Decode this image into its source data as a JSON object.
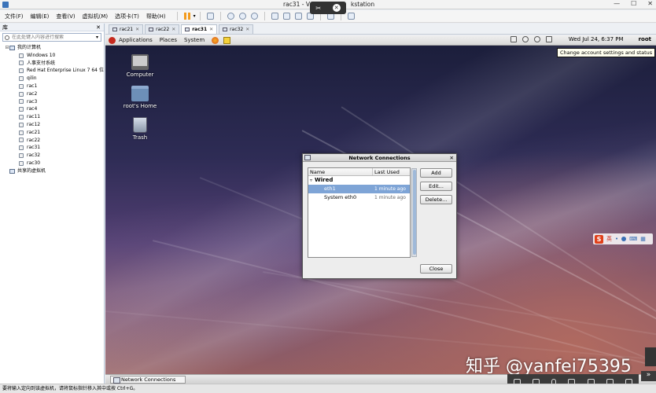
{
  "window": {
    "title": "rac31 - VMware Workstation",
    "title_visible": "rac31 - V",
    "title_tail": "kstation",
    "controls": [
      "minimize-icon",
      "maximize-icon",
      "close-icon"
    ]
  },
  "remote_pill": {
    "icons": [
      "pin-icon",
      "close-icon"
    ]
  },
  "menu": {
    "items": [
      "文件(F)",
      "编辑(E)",
      "查看(V)",
      "虚拟机(M)",
      "选项卡(T)",
      "帮助(H)"
    ]
  },
  "library": {
    "title": "库",
    "search_placeholder": "在此处键入内容进行搜索",
    "root": "我的计算机",
    "vms": [
      "Windows 10",
      "人事支付系统",
      "Red Hat Enterprise Linux 7 64 位",
      "qilin",
      "rac1",
      "rac2",
      "rac3",
      "rac4",
      "rac11",
      "rac12",
      "rac21",
      "rac22",
      "rac31",
      "rac32",
      "rac30"
    ],
    "shared": "共享的虚拟机"
  },
  "tabs": [
    {
      "label": "rac21",
      "active": false
    },
    {
      "label": "rac22",
      "active": false
    },
    {
      "label": "rac31",
      "active": true
    },
    {
      "label": "rac32",
      "active": false
    }
  ],
  "guest_panel": {
    "applications": "Applications",
    "places": "Places",
    "system": "System",
    "clock": "Wed Jul 24,  6:37 PM",
    "user": "root",
    "tooltip": "Change account settings and status"
  },
  "desktop_icons": [
    {
      "label": "Computer",
      "icon": "computer-icon"
    },
    {
      "label": "root's Home",
      "icon": "home-folder-icon"
    },
    {
      "label": "Trash",
      "icon": "trash-icon"
    }
  ],
  "dialog": {
    "title": "Network Connections",
    "col_name": "Name",
    "col_last": "Last Used",
    "group": "Wired",
    "rows": [
      {
        "name": "eth1",
        "last": "1 minute ago",
        "selected": true
      },
      {
        "name": "System eth0",
        "last": "1 minute ago",
        "selected": false
      }
    ],
    "add": "Add",
    "edit": "Edit...",
    "delete": "Delete...",
    "close": "Close"
  },
  "taskbar": {
    "item": "Network Connections"
  },
  "ime": {
    "logo": "S",
    "lang": "英"
  },
  "watermark": "知乎 @yanfei75395",
  "statusbar": "要将输入定向到该虚拟机，请将鼠标指针移入其中或按 Ctrl+G。",
  "colors": {
    "selection": "#7ea4d6",
    "pause": "#f39a1c",
    "redhat": "#c62a1e"
  }
}
